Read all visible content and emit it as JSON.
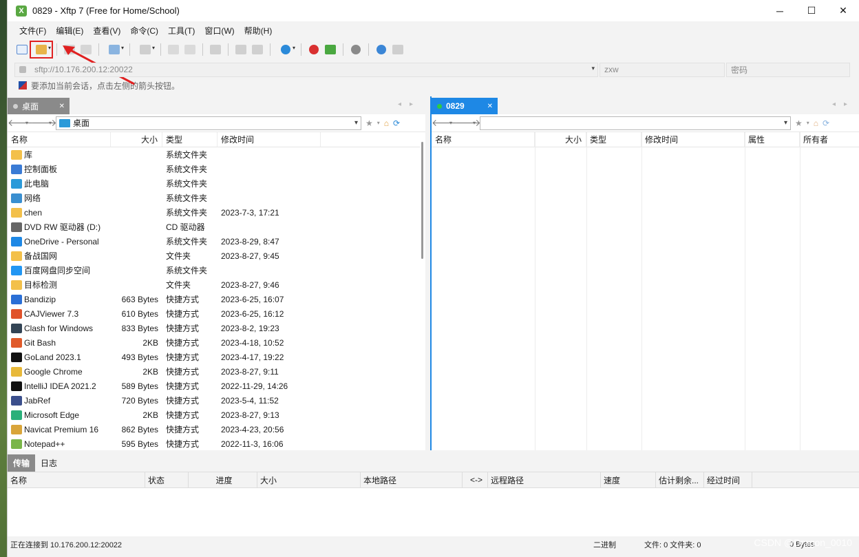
{
  "window": {
    "title": "0829 - Xftp 7 (Free for Home/School)",
    "logo": "Xftp"
  },
  "menu": [
    "文件(F)",
    "编辑(E)",
    "查看(V)",
    "命令(C)",
    "工具(T)",
    "窗口(W)",
    "帮助(H)"
  ],
  "address": {
    "host": "sftp://10.176.200.12:20022",
    "user_placeholder": "zxw",
    "password_placeholder": "密码"
  },
  "hint": "要添加当前会话，点击左侧的箭头按钮。",
  "left_pane": {
    "tab_label": "桌面",
    "path": "桌面",
    "columns": [
      "名称",
      "大小",
      "类型",
      "修改时间"
    ],
    "rows": [
      {
        "name": "库",
        "size": "",
        "type": "系统文件夹",
        "time": "",
        "icon": "#f3c04a"
      },
      {
        "name": "控制面板",
        "size": "",
        "type": "系统文件夹",
        "time": "",
        "icon": "#3a7bd5"
      },
      {
        "name": "此电脑",
        "size": "",
        "type": "系统文件夹",
        "time": "",
        "icon": "#2b9ad9"
      },
      {
        "name": "网络",
        "size": "",
        "type": "系统文件夹",
        "time": "",
        "icon": "#3a8fd0"
      },
      {
        "name": "chen",
        "size": "",
        "type": "系统文件夹",
        "time": "2023-7-3, 17:21",
        "icon": "#f3c04a"
      },
      {
        "name": "DVD RW 驱动器 (D:)",
        "size": "",
        "type": "CD 驱动器",
        "time": "",
        "icon": "#666666"
      },
      {
        "name": "OneDrive - Personal",
        "size": "",
        "type": "系统文件夹",
        "time": "2023-8-29, 8:47",
        "icon": "#1e88e5"
      },
      {
        "name": "备战国网",
        "size": "",
        "type": "文件夹",
        "time": "2023-8-27, 9:45",
        "icon": "#f3c04a"
      },
      {
        "name": "百度网盘同步空间",
        "size": "",
        "type": "系统文件夹",
        "time": "",
        "icon": "#2196f3"
      },
      {
        "name": "目标检测",
        "size": "",
        "type": "文件夹",
        "time": "2023-8-27, 9:46",
        "icon": "#f3c04a"
      },
      {
        "name": "Bandizip",
        "size": "663 Bytes",
        "type": "快捷方式",
        "time": "2023-6-25, 16:07",
        "icon": "#2a6fd6"
      },
      {
        "name": "CAJViewer 7.3",
        "size": "610 Bytes",
        "type": "快捷方式",
        "time": "2023-6-25, 16:12",
        "icon": "#e0522a"
      },
      {
        "name": "Clash for Windows",
        "size": "833 Bytes",
        "type": "快捷方式",
        "time": "2023-8-2, 19:23",
        "icon": "#334455"
      },
      {
        "name": "Git Bash",
        "size": "2KB",
        "type": "快捷方式",
        "time": "2023-4-18, 10:52",
        "icon": "#e05a2a"
      },
      {
        "name": "GoLand 2023.1",
        "size": "493 Bytes",
        "type": "快捷方式",
        "time": "2023-4-17, 19:22",
        "icon": "#111111"
      },
      {
        "name": "Google Chrome",
        "size": "2KB",
        "type": "快捷方式",
        "time": "2023-8-27, 9:11",
        "icon": "#e8b93a"
      },
      {
        "name": "IntelliJ IDEA 2021.2",
        "size": "589 Bytes",
        "type": "快捷方式",
        "time": "2022-11-29, 14:26",
        "icon": "#111111"
      },
      {
        "name": "JabRef",
        "size": "720 Bytes",
        "type": "快捷方式",
        "time": "2023-5-4, 11:52",
        "icon": "#3b4f8c"
      },
      {
        "name": "Microsoft Edge",
        "size": "2KB",
        "type": "快捷方式",
        "time": "2023-8-27, 9:13",
        "icon": "#2ab07a"
      },
      {
        "name": "Navicat Premium 16",
        "size": "862 Bytes",
        "type": "快捷方式",
        "time": "2023-4-23, 20:56",
        "icon": "#d9a53a"
      },
      {
        "name": "Notepad++",
        "size": "595 Bytes",
        "type": "快捷方式",
        "time": "2022-11-3, 16:06",
        "icon": "#7ab648"
      }
    ]
  },
  "right_pane": {
    "tab_label": "0829",
    "path": "",
    "columns": [
      "名称",
      "大小",
      "类型",
      "修改时间",
      "属性",
      "所有者"
    ]
  },
  "transfer": {
    "tabs": [
      "传输",
      "日志"
    ],
    "columns": [
      "名称",
      "状态",
      "进度",
      "大小",
      "本地路径",
      "<->",
      "远程路径",
      "速度",
      "估计剩余...",
      "经过时间"
    ]
  },
  "status": {
    "connecting": "正在连接到 10.176.200.12:20022",
    "mode": "二进制",
    "files": "文件: 0  文件夹: 0",
    "bytes": "0 Bytes"
  },
  "watermark": "CSDN @Dragon_0010",
  "colors": {
    "accent": "#1e88e5",
    "highlight": "#e02020"
  }
}
